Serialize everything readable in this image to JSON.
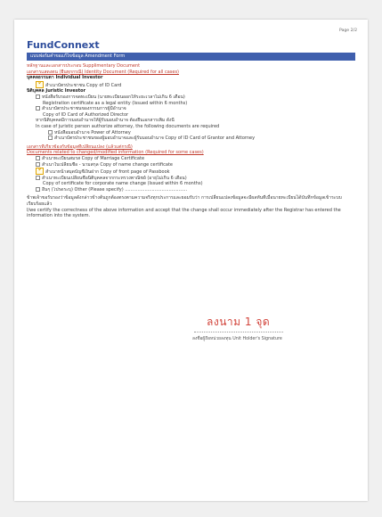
{
  "page_label": "Page 2/2",
  "brand": "FundConnext",
  "form_title": "แบบฟอร์มคำขอแก้ไขข้อมูล  Amendment Form",
  "section_supporting": "หลักฐานและเอกสารประกอบ  Supplimentary Document",
  "section_identity": "เอกสารแสดงตน (ยื่นทุกกรณี)  Identity Document (Required for all cases)",
  "individual_header": "บุคคลธรรมดา  Individual Investor",
  "individual_item": "สำเนาบัตรประชาชน  Copy of ID Card",
  "juristic_header": "นิติบุคคล  Juristic Investor",
  "juristic_item1_th": "หนังสือรับรองการจดทะเบียน (นายทะเบียนออกให้ระยะเวลาไม่เกิน 6 เดือน)",
  "juristic_item1_en": "Registration certificate as a legal entity (Issued within 6 months)",
  "juristic_item2_th": "สำเนาบัตรประชาชนของกรรมการผู้มีอำนาจ",
  "juristic_item2_en": "Copy of ID Card of Authorized Director",
  "authorize_th": "หากนิติบุคคลมีการมอบอำนาจให้ผู้รับมอบอำนาจ ต้องยื่นเอกสารเพิ่ม ดังนี้",
  "authorize_en": "In case of juristic person authorize attorney, the following documents are required",
  "poa_item": "หนังสือมอบอำนาจ    Power of Attorney",
  "grantor_item": "สำเนาบัตรประชาชนของผู้มอบอำนาจและผู้รับมอบอำนาจ  Copy of ID Card of Grantor and Attorney",
  "section_related_th": "เอกสารที่เกี่ยวข้องกับข้อมูลที่เปลี่ยนแปลง (แล้วแต่กรณี)",
  "section_related_en": "Documents related to changed/modified information (Required for some cases)",
  "related_items": [
    "สำเนาทะเบียนสมรส  Copy of Marriage Certificate",
    "สำเนาใบเปลี่ยนชื่อ - นามสกุล  Copy of name change certificate",
    "สำเนาหน้าสมุดบัญชีเงินฝาก  Copy of front page of Passbook",
    "สำเนาทะเบียนเปลี่ยนชื่อนิติบุคคลจากกระทรวงพาณิชย์ (อายุไม่เกิน 6 เดือน)"
  ],
  "related_item4_en": "Copy of certificate for corporate name change  (Issued within 6 months)",
  "other_item": "อื่นๆ (โปรดระบุ)  Other (Please specify)  ............................................",
  "certify_th": "ข้าพเจ้าขอรับรองว่าข้อมูลดังกล่าวข้างต้นถูกต้องตรงตามความจริงทุกประการและยอมรับว่า การเปลี่ยนแปลงข้อมูลจะมีผลทันทีเมื่อนายทะเบียนได้บันทึกข้อมูลเข้าระบบเรียบร้อยแล้ว",
  "certify_en": "I/we certify the correctness of the above information and accept that the change shall occur immediately after the Registrar has entered the information into the system.",
  "signature_text": "ลงนาม 1 จุด",
  "signature_caption": "ลงชื่อผู้ถือหน่วยลงทุน Unit Holder's Signature",
  "colors": {
    "brand": "#2f4e9c",
    "title_bar": "#3f5fad",
    "accent_red": "#c0392b",
    "check": "#e0a400",
    "signature": "#d2443b"
  }
}
